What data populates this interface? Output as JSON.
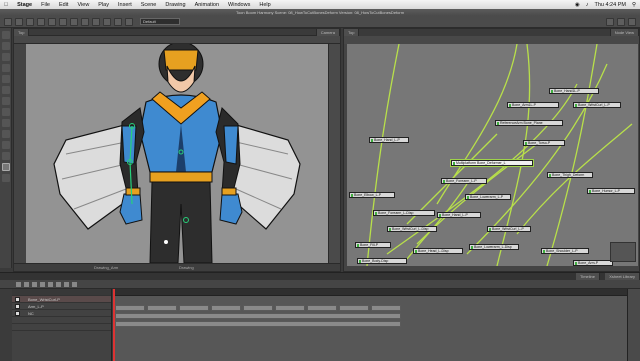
{
  "menubar": {
    "app": "Stage",
    "items": [
      "File",
      "Edit",
      "View",
      "Play",
      "Insert",
      "Scene",
      "Drawing",
      "Animation",
      "Windows",
      "Help"
    ],
    "clock": "Thu 4:24 PM"
  },
  "titlebar": {
    "title": "Toon Boom Harmony Scene: 08_HowToCutBonesDeform Version: 08_HowToCutBonesDeform"
  },
  "toolbar": {
    "select_value": "Default"
  },
  "camera": {
    "tab_label": "Top",
    "tab2_label": "Camera",
    "status_left": "Drawing_Arm",
    "status_mid": "Drawing"
  },
  "node_view": {
    "tab_label": "Top",
    "tab2_label": "Node View",
    "nodes": [
      {
        "label": "ReferenceArm Bone_Plane"
      },
      {
        "label": "Bone_Arm1L-P"
      },
      {
        "label": "Bone_Hand1L-P"
      },
      {
        "label": "Bone_Torso-P"
      },
      {
        "label": "Bone_WristCurl_L-P"
      },
      {
        "label": "Bone_Hand_L-P"
      },
      {
        "label": "Bone_Thigh_Deform"
      },
      {
        "label": "Bone_Forearm_L-P"
      },
      {
        "label": "Multiplatform Bone_Deformer_L"
      },
      {
        "label": "Bone_Elbow_L-P"
      },
      {
        "label": "Bone_Lowerarm_L-P"
      },
      {
        "label": "Bone_Humor_L-P"
      },
      {
        "label": "Bone_Forearm_L-Disp"
      },
      {
        "label": "Bone_Hand_L-P"
      },
      {
        "label": "Bone_WristCurl_L-P"
      },
      {
        "label": "Bone_WristCurl_L-Disp"
      },
      {
        "label": "Bone_Lowerarm_L-Disp"
      },
      {
        "label": "Bone_Shoulder_L-P"
      },
      {
        "label": "Bone_Fill-P"
      },
      {
        "label": "Bone_Head_L-Disp"
      },
      {
        "label": "Bone_Body-Disp"
      },
      {
        "label": "Bone_Arm-P"
      }
    ]
  },
  "timeline": {
    "tab_right_1": "Timeline",
    "tab_right_2": "Xsheet Library",
    "layers": [
      {
        "name": "Bone_WristCurl-P"
      },
      {
        "name": "Arm_L-P"
      },
      {
        "name": "NC"
      },
      {
        "name": ""
      },
      {
        "name": ""
      }
    ]
  }
}
